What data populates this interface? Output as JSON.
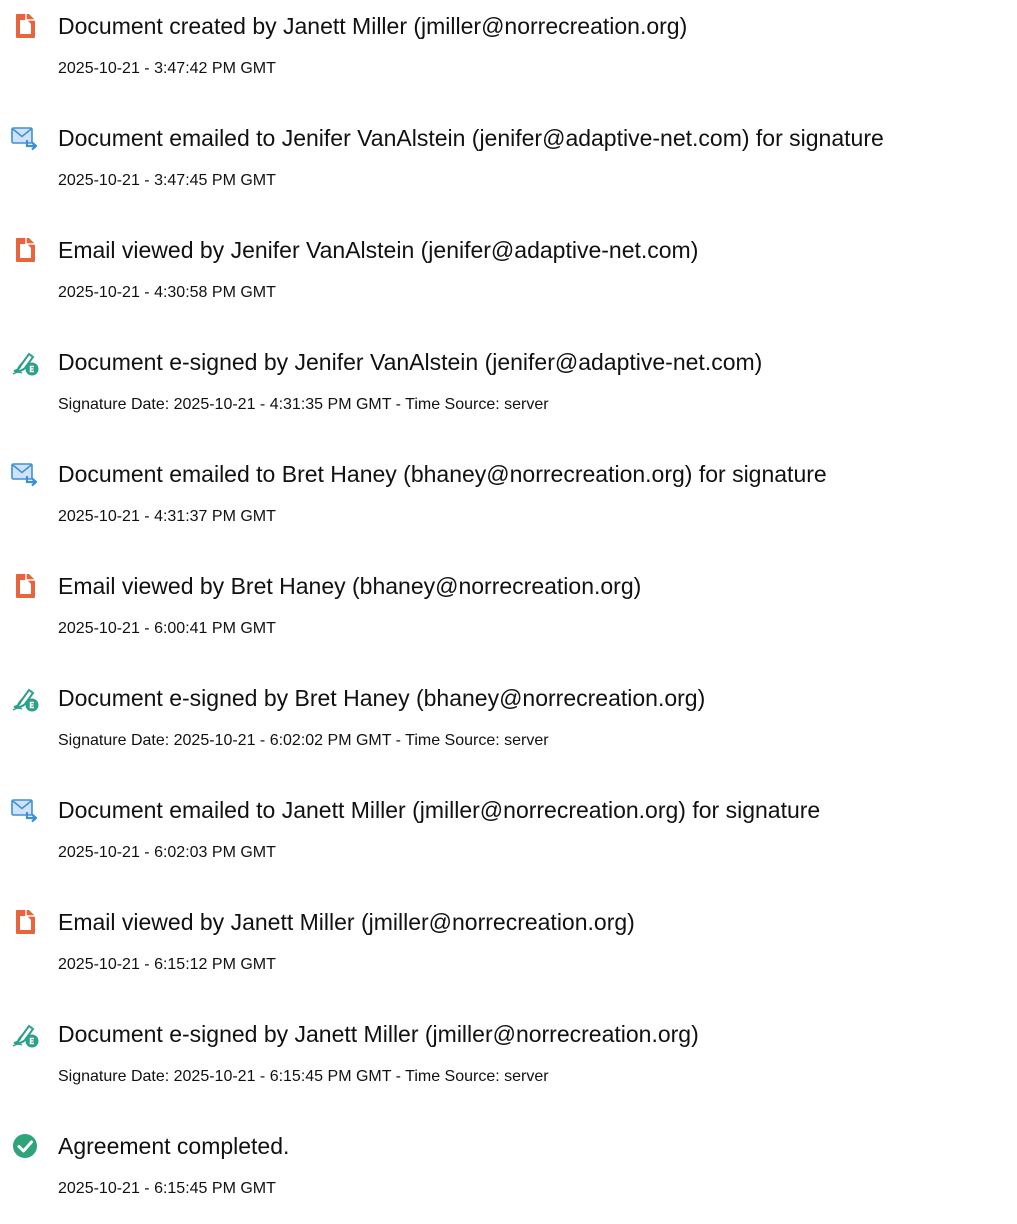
{
  "colors": {
    "document_icon": "#e8643c",
    "email_icon": "#3d8fd6",
    "sign_icon": "#2e9f8a",
    "complete_icon": "#2fa37a"
  },
  "events": [
    {
      "icon": "document-icon",
      "title": "Document created by Janett Miller (jmiller@norrecreation.org)",
      "meta": "2025-10-21 - 3:47:42 PM GMT"
    },
    {
      "icon": "email-icon",
      "title": "Document emailed to Jenifer VanAlstein (jenifer@adaptive-net.com) for signature",
      "meta": "2025-10-21 - 3:47:45 PM GMT"
    },
    {
      "icon": "document-icon",
      "title": "Email viewed by Jenifer VanAlstein (jenifer@adaptive-net.com)",
      "meta": "2025-10-21 - 4:30:58 PM GMT"
    },
    {
      "icon": "e-sign-icon",
      "title": "Document e-signed by Jenifer VanAlstein (jenifer@adaptive-net.com)",
      "meta": "Signature Date: 2025-10-21 - 4:31:35 PM GMT - Time Source: server"
    },
    {
      "icon": "email-icon",
      "title": "Document emailed to Bret Haney (bhaney@norrecreation.org) for signature",
      "meta": "2025-10-21 - 4:31:37 PM GMT"
    },
    {
      "icon": "document-icon",
      "title": "Email viewed by Bret Haney (bhaney@norrecreation.org)",
      "meta": "2025-10-21 - 6:00:41 PM GMT"
    },
    {
      "icon": "e-sign-icon",
      "title": "Document e-signed by Bret Haney (bhaney@norrecreation.org)",
      "meta": "Signature Date: 2025-10-21 - 6:02:02 PM GMT - Time Source: server"
    },
    {
      "icon": "email-icon",
      "title": "Document emailed to Janett Miller (jmiller@norrecreation.org) for signature",
      "meta": "2025-10-21 - 6:02:03 PM GMT"
    },
    {
      "icon": "document-icon",
      "title": "Email viewed by Janett Miller (jmiller@norrecreation.org)",
      "meta": "2025-10-21 - 6:15:12 PM GMT"
    },
    {
      "icon": "e-sign-icon",
      "title": "Document e-signed by Janett Miller (jmiller@norrecreation.org)",
      "meta": "Signature Date: 2025-10-21 - 6:15:45 PM GMT - Time Source: server"
    },
    {
      "icon": "check-circle-icon",
      "title": "Agreement completed.",
      "meta": "2025-10-21 - 6:15:45 PM GMT"
    }
  ]
}
